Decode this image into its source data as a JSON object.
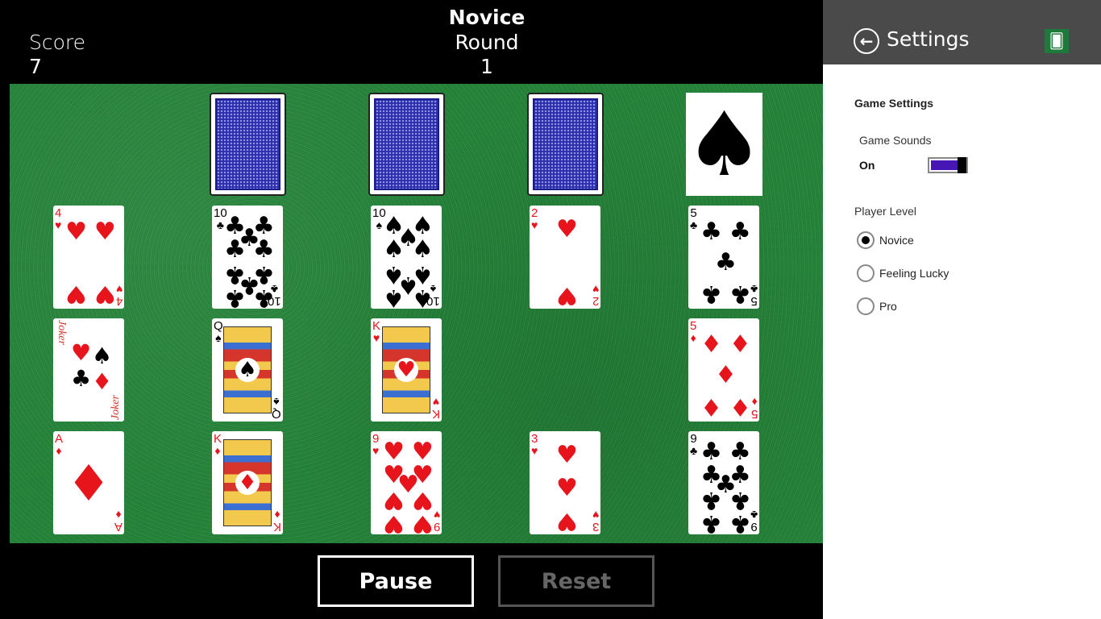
{
  "header": {
    "score_label": "Score",
    "score_value": "7",
    "level_title": "Novice",
    "round_label": "Round",
    "round_value": "1"
  },
  "board": {
    "face_down_cards": 3,
    "foundation_suit": "♠",
    "rows": [
      [
        {
          "rank": "4",
          "suit": "♥",
          "color": "red"
        },
        {
          "rank": "10",
          "suit": "♣",
          "color": "black"
        },
        {
          "rank": "10",
          "suit": "♠",
          "color": "black"
        },
        {
          "rank": "2",
          "suit": "♥",
          "color": "red"
        },
        {
          "rank": "5",
          "suit": "♣",
          "color": "black"
        }
      ],
      [
        {
          "rank": "Joker",
          "suit": "",
          "color": "red"
        },
        {
          "rank": "Q",
          "suit": "♠",
          "color": "black"
        },
        {
          "rank": "K",
          "suit": "♥",
          "color": "red"
        },
        null,
        {
          "rank": "5",
          "suit": "♦",
          "color": "red"
        }
      ],
      [
        {
          "rank": "A",
          "suit": "♦",
          "color": "red"
        },
        {
          "rank": "K",
          "suit": "♦",
          "color": "red"
        },
        {
          "rank": "9",
          "suit": "♥",
          "color": "red"
        },
        {
          "rank": "3",
          "suit": "♥",
          "color": "red"
        },
        {
          "rank": "9",
          "suit": "♣",
          "color": "black"
        }
      ]
    ]
  },
  "buttons": {
    "pause": "Pause",
    "reset": "Reset"
  },
  "settings": {
    "title": "Settings",
    "back_icon": "back-arrow-icon",
    "logo_icon": "cards-logo-icon",
    "section_title": "Game Settings",
    "sounds_label": "Game Sounds",
    "sounds_state": "On",
    "toggle_color": "#4617b4",
    "player_level_label": "Player Level",
    "levels": [
      "Novice",
      "Feeling Lucky",
      "Pro"
    ],
    "selected_level": "Novice"
  }
}
